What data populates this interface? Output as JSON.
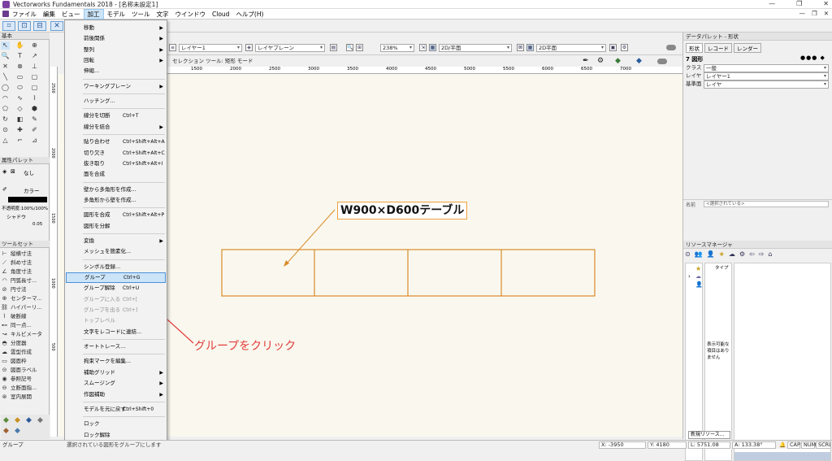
{
  "window": {
    "title": "Vectorworks Fundamentals 2018 - [名称未設定1]",
    "controls": [
      "—",
      "❐",
      "✕"
    ]
  },
  "menubar": {
    "items": [
      "ファイル",
      "編集",
      "ビュー",
      "加工",
      "モデル",
      "ツール",
      "文字",
      "ウインドウ",
      "Cloud",
      "ヘルプ(H)"
    ],
    "active": "加工",
    "mdi_controls": [
      "—",
      "❐",
      "✕"
    ]
  },
  "toolbar": {
    "layer": "レイヤー1",
    "layer_plane": "レイヤプレーン",
    "zoom": "238%",
    "view": "2D/平面",
    "render": "2D平面",
    "mode_text": "セレクション ツール: 矩形 モード"
  },
  "ruler": {
    "top_labels": [
      "1500",
      "2000",
      "2500",
      "3000",
      "3500",
      "4000",
      "4500",
      "5000",
      "5500",
      "6000",
      "6500",
      "7000"
    ],
    "left_labels": [
      "2500",
      "2000",
      "1500",
      "1000",
      "500"
    ]
  },
  "left_panel": {
    "basic_title": "基本",
    "attr_title": "属性パレット",
    "attr_none": "なし",
    "attr_color": "カラー",
    "opacity": "不透明度:100%/100%",
    "shadow": "シャドウ",
    "opacity_value": "0.05",
    "toolset_title": "ツールセット",
    "toolset_items": [
      "縦横寸法",
      "斜め寸法",
      "角度寸法",
      "円弧長寸...",
      "円寸法",
      "センターマ...",
      "ハイパーリ...",
      "破断線",
      "同一点...",
      "キルビメータ",
      "分度器",
      "雲型作成",
      "図面枠",
      "図面ラベル",
      "参照記号",
      "立断面指...",
      "室内展開"
    ]
  },
  "menu": {
    "items": [
      {
        "label": "移動",
        "arrow": true
      },
      {
        "label": "前後関係",
        "arrow": true
      },
      {
        "label": "整列",
        "arrow": true
      },
      {
        "label": "回転",
        "arrow": true
      },
      {
        "label": "伸縮..."
      },
      {
        "sep": true
      },
      {
        "label": "ワーキングプレーン",
        "arrow": true
      },
      {
        "sep": true
      },
      {
        "label": "ハッチング..."
      },
      {
        "sep": true
      },
      {
        "label": "線分を切断",
        "sc": "Ctrl+T"
      },
      {
        "label": "線分を結合",
        "arrow": true
      },
      {
        "sep": true
      },
      {
        "label": "貼り合わせ",
        "sc": "Ctrl+Shift+Alt+A"
      },
      {
        "label": "切り欠き",
        "sc": "Ctrl+Shift+Alt+C"
      },
      {
        "label": "抜き取り",
        "sc": "Ctrl+Shift+Alt+I"
      },
      {
        "label": "面を合成"
      },
      {
        "sep": true
      },
      {
        "label": "壁から多角形を作成..."
      },
      {
        "label": "多角形から壁を作成..."
      },
      {
        "sep": true
      },
      {
        "label": "図形を合成",
        "sc": "Ctrl+Shift+Alt+P"
      },
      {
        "label": "図形を分解"
      },
      {
        "sep": true
      },
      {
        "label": "変換",
        "arrow": true
      },
      {
        "label": "メッシュを簡素化..."
      },
      {
        "sep": true
      },
      {
        "label": "シンボル登録..."
      },
      {
        "label": "グループ",
        "sc": "Ctrl+G",
        "hl": true
      },
      {
        "label": "グループ解除",
        "sc": "Ctrl+U"
      },
      {
        "label": "グループに入る",
        "sc": "Ctrl+[",
        "disabled": true
      },
      {
        "label": "グループを出る",
        "sc": "Ctrl+]",
        "disabled": true
      },
      {
        "label": "トップレベル",
        "disabled": true
      },
      {
        "label": "文字をレコードに連結..."
      },
      {
        "sep": true
      },
      {
        "label": "オートトレース..."
      },
      {
        "sep": true
      },
      {
        "label": "拘束マークを編集..."
      },
      {
        "label": "補助グリッド",
        "arrow": true
      },
      {
        "label": "スムージング",
        "arrow": true
      },
      {
        "label": "作図補助",
        "arrow": true
      },
      {
        "sep": true
      },
      {
        "label": "モデルを元に戻す",
        "sc": "Ctrl+Shift+0"
      },
      {
        "sep": true
      },
      {
        "label": "ロック"
      },
      {
        "label": "ロック解除"
      }
    ]
  },
  "canvas": {
    "annotation_label": "W900×D600テーブル",
    "instruction": "グループをクリック"
  },
  "data_palette": {
    "title": "データパレット - 形状",
    "tabs": [
      "形状",
      "レコード",
      "レンダー"
    ],
    "count_label": "7 図形",
    "rows": [
      {
        "label": "クラス",
        "value": "一般"
      },
      {
        "label": "レイヤ",
        "value": "レイヤー1"
      },
      {
        "label": "基準面",
        "value": "レイヤ"
      }
    ],
    "name_label": "名前",
    "name_value": "<選択されている>"
  },
  "resource_manager": {
    "title": "リソースマネージャ",
    "col_header": "タイプ",
    "empty_text": "表示可能な項目はありません",
    "new_button": "新規リソース..."
  },
  "status": {
    "left": "グループ",
    "hint": "選択されている図形をグループにします",
    "x": "X: -3950",
    "y": "Y: 4180",
    "l": "L: 5751.08",
    "a": "A: 133.38°",
    "caps": "CAP",
    "num": "NUM",
    "scrl": "SCRL"
  }
}
